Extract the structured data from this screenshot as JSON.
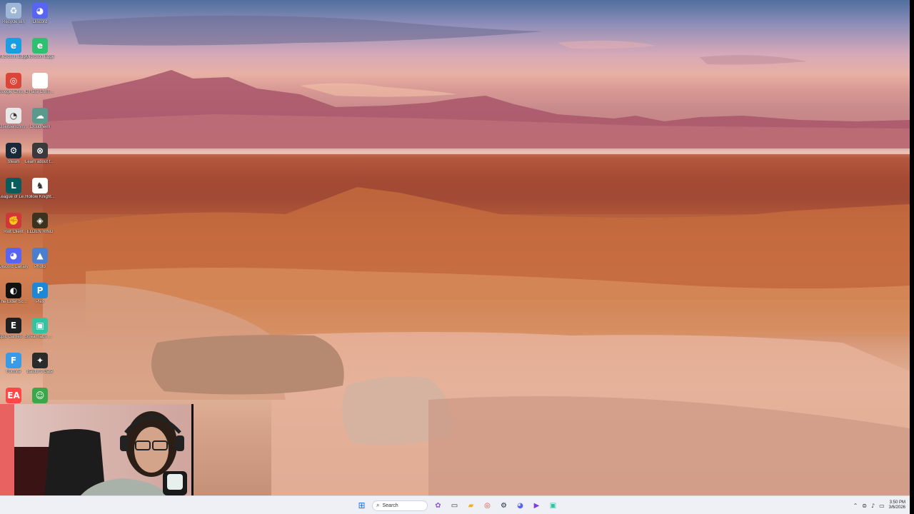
{
  "desktop": {
    "icons": [
      {
        "label": "Recycle Bin",
        "icon": "recycle-bin-icon",
        "color": "#9fb7d6",
        "glyph": "♻"
      },
      {
        "label": "Discord",
        "icon": "discord-icon",
        "color": "#5865f2",
        "glyph": "◕"
      },
      {
        "label": "Microsoft Edge",
        "icon": "edge-icon",
        "color": "#1b9de2",
        "glyph": "e"
      },
      {
        "label": "Microsoft Edge",
        "icon": "edge-icon",
        "color": "#2fbf71",
        "glyph": "e"
      },
      {
        "label": "Google Chrome",
        "icon": "chrome-icon",
        "color": "#db4437",
        "glyph": "◎"
      },
      {
        "label": "O'Hara Christian -...",
        "icon": "document-icon",
        "color": "#ffffff",
        "glyph": ""
      },
      {
        "label": "UserBenchm...",
        "icon": "userbenchmark-icon",
        "color": "#e8e8e8",
        "glyph": "◔"
      },
      {
        "label": "Cloudheim",
        "icon": "cloudheim-icon",
        "color": "#5a9a8c",
        "glyph": "☁"
      },
      {
        "label": "Steam",
        "icon": "steam-icon",
        "color": "#1b2838",
        "glyph": "⚙"
      },
      {
        "label": "Learn about this picture",
        "icon": "learn-picture-icon",
        "color": "#3a3a3a",
        "glyph": "⊗"
      },
      {
        "label": "League of Legends",
        "icon": "league-icon",
        "color": "#0a5c5c",
        "glyph": "L"
      },
      {
        "label": "Hollow Knight...",
        "icon": "hollow-knight-icon",
        "color": "#ffffff",
        "glyph": "♞"
      },
      {
        "label": "Riot Client",
        "icon": "riot-client-icon",
        "color": "#d13639",
        "glyph": "✊"
      },
      {
        "label": "ELDEN RING",
        "icon": "elden-ring-icon",
        "color": "#3b3320",
        "glyph": "◈"
      },
      {
        "label": "Discord Canary",
        "icon": "discord-icon",
        "color": "#5865f2",
        "glyph": "◕"
      },
      {
        "label": "Photo",
        "icon": "photo-icon",
        "color": "#4a7fd0",
        "glyph": "▲"
      },
      {
        "label": "The Elder Scrolls V...",
        "icon": "skyrim-icon",
        "color": "#111111",
        "glyph": "◐"
      },
      {
        "label": "Plex",
        "icon": "plex-icon",
        "color": "#1e88d8",
        "glyph": "P"
      },
      {
        "label": "Epic Games Launcher",
        "icon": "epic-games-icon",
        "color": "#202020",
        "glyph": "E"
      },
      {
        "label": "Streamlabs Desktop",
        "icon": "streamlabs-icon",
        "color": "#31c3a2",
        "glyph": "▣"
      },
      {
        "label": "Fortnite",
        "icon": "fortnite-icon",
        "color": "#3a9ae6",
        "glyph": "F"
      },
      {
        "label": "Baldur's Gate",
        "icon": "baldurs-gate-icon",
        "color": "#2b2b2b",
        "glyph": "✦"
      },
      {
        "label": "EA",
        "icon": "ea-icon",
        "color": "#ff4747",
        "glyph": "EA"
      },
      {
        "label": "",
        "icon": "game-icon",
        "color": "#3aa84a",
        "glyph": "☺"
      }
    ]
  },
  "taskbar": {
    "search_placeholder": "Search",
    "apps": [
      {
        "icon": "start-icon",
        "color": "#1a73e8",
        "glyph": "⊞"
      },
      {
        "icon": "widget-icon",
        "color": "#8a5cd1",
        "glyph": "✿"
      },
      {
        "icon": "task-view-icon",
        "color": "#333333",
        "glyph": "▭"
      },
      {
        "icon": "file-explorer-icon",
        "color": "#f2b01e",
        "glyph": "▰"
      },
      {
        "icon": "chrome-icon",
        "color": "#db4437",
        "glyph": "◎"
      },
      {
        "icon": "steam-icon",
        "color": "#1b2838",
        "glyph": "⚙"
      },
      {
        "icon": "discord-icon",
        "color": "#5865f2",
        "glyph": "◕"
      },
      {
        "icon": "video-editor-icon",
        "color": "#7b3fe4",
        "glyph": "▶"
      },
      {
        "icon": "streamlabs-icon",
        "color": "#31c3a2",
        "glyph": "▣"
      }
    ],
    "clock_time": "3:50 PM",
    "clock_date": "3/6/2026"
  }
}
